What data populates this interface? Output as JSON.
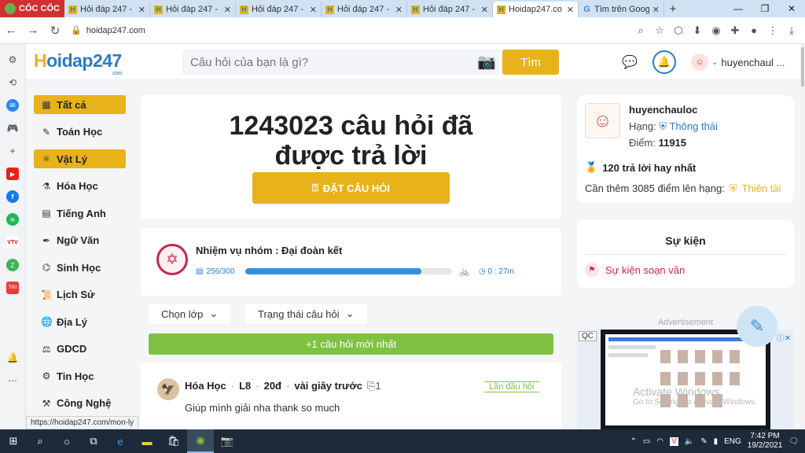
{
  "browser": {
    "logo": "CỐC CỐC",
    "tabs": [
      {
        "title": "Hỏi đáp 247 -",
        "active": false
      },
      {
        "title": "Hỏi đáp 247 -",
        "active": false
      },
      {
        "title": "Hỏi đáp 247 -",
        "active": false
      },
      {
        "title": "Hỏi đáp 247 -",
        "active": false
      },
      {
        "title": "Hỏi đáp 247 -",
        "active": false
      },
      {
        "title": "Hoidap247.co",
        "active": true
      },
      {
        "title": "Tìm trên Goog",
        "active": false
      }
    ],
    "url": "hoidap247.com",
    "status_url": "https://hoidap247.com/mon-ly"
  },
  "header": {
    "logo_h": "H",
    "logo_rest": "oidap247",
    "logo_com": ".com",
    "search_placeholder": "Câu hỏi của bạn là gì?",
    "search_button": "Tìm",
    "username": "huyenchaul ..."
  },
  "subjects": [
    {
      "label": "Tất cả",
      "icon": "grid-icon",
      "active": true
    },
    {
      "label": "Toán Học",
      "icon": "math-icon",
      "active": false
    },
    {
      "label": "Vật Lý",
      "icon": "physics-icon",
      "active": true
    },
    {
      "label": "Hóa Học",
      "icon": "flask-icon",
      "active": false
    },
    {
      "label": "Tiếng Anh",
      "icon": "book-icon",
      "active": false
    },
    {
      "label": "Ngữ Văn",
      "icon": "pen-icon",
      "active": false
    },
    {
      "label": "Sinh Học",
      "icon": "dna-icon",
      "active": false
    },
    {
      "label": "Lịch Sử",
      "icon": "scroll-icon",
      "active": false
    },
    {
      "label": "Địa Lý",
      "icon": "globe-icon",
      "active": false
    },
    {
      "label": "GDCD",
      "icon": "law-icon",
      "active": false
    },
    {
      "label": "Tin Học",
      "icon": "gear-icon",
      "active": false
    },
    {
      "label": "Công Nghệ",
      "icon": "tech-icon",
      "active": false
    }
  ],
  "hero": {
    "title_line1": "1243023 câu hỏi đã",
    "title_line2": "được trả lời",
    "ask_button": "ĐẶT CÂU HỎI"
  },
  "mission": {
    "title": "Nhiệm vụ nhóm : Đại đoàn kết",
    "count": "256/300",
    "progress_fraction": 0.853,
    "time": "0 : 27m"
  },
  "filters": {
    "grade": "Chọn lớp",
    "status": "Trạng thái câu hỏi",
    "newest": "+1 câu hỏi mới nhất"
  },
  "question": {
    "subject": "Hóa Học",
    "grade": "L8",
    "points": "20đ",
    "time": "vài giây trước",
    "attachments": "1",
    "tag": "Lần đầu hỏi",
    "text": "Giúp mình giải nha thank so much"
  },
  "profile": {
    "name": "huyenchauloc",
    "rank_label": "Hạng:",
    "rank_value": "Thông thái",
    "score_label": "Điểm:",
    "score_value": "11915",
    "best_answers": "120 trả lời hay nhất",
    "need_text": "Cần thêm 3085 điểm lên hạng:",
    "next_rank": "Thiên tài"
  },
  "events": {
    "title": "Sự kiện",
    "item": "Sự kiện soạn văn"
  },
  "ad": {
    "label": "Advertisement",
    "qc": "QC",
    "activate_title": "Activate Windows",
    "activate_sub": "Go to Settings to activate Windows."
  },
  "taskbar": {
    "lang": "ENG",
    "time": "7:42 PM",
    "date": "19/2/2021"
  }
}
